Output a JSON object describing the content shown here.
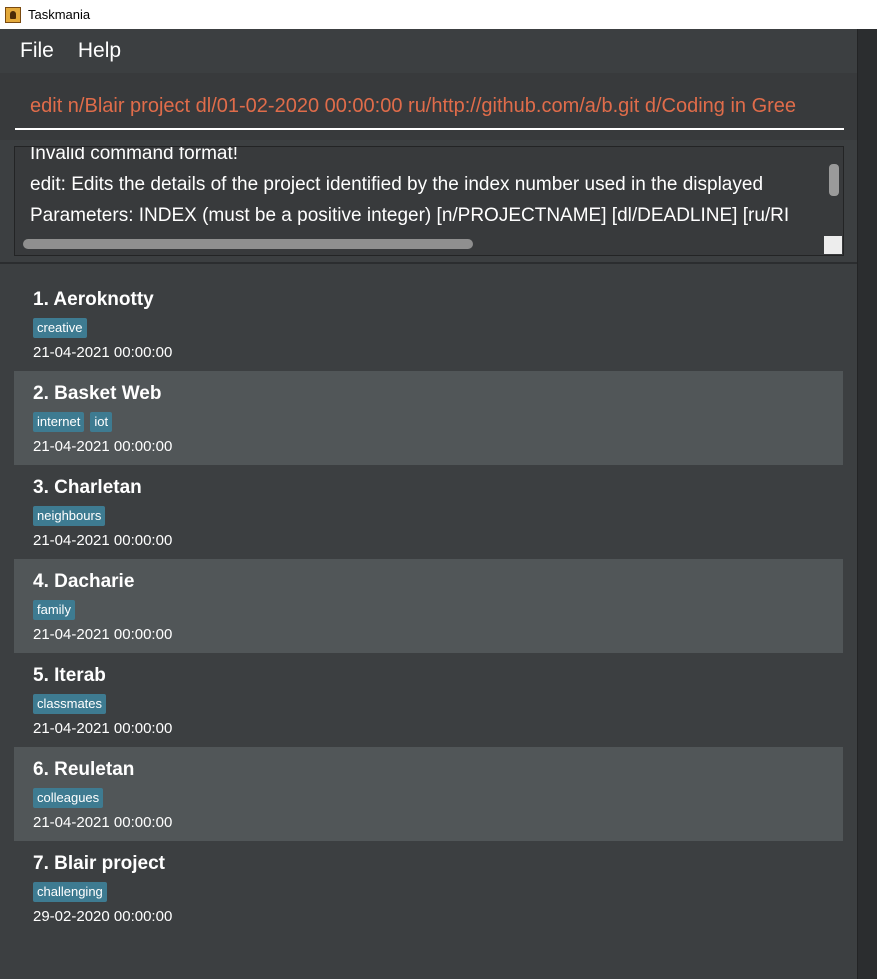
{
  "window": {
    "title": "Taskmania"
  },
  "menu": {
    "file": "File",
    "help": "Help"
  },
  "command": {
    "value": "edit n/Blair project dl/01-02-2020 00:00:00 ru/http://github.com/a/b.git d/Coding in Gree"
  },
  "result": {
    "lines": [
      "Invalid command format!",
      "edit: Edits the details of the project identified by the index number used in the displayed",
      "Parameters: INDEX (must be a positive integer) [n/PROJECTNAME] [dl/DEADLINE] [ru/RI"
    ]
  },
  "projects": [
    {
      "title": "1.  Aeroknotty",
      "tags": [
        "creative"
      ],
      "date": "21-04-2021 00:00:00"
    },
    {
      "title": "2.  Basket Web",
      "tags": [
        "internet",
        "iot"
      ],
      "date": "21-04-2021 00:00:00"
    },
    {
      "title": "3.  Charletan",
      "tags": [
        "neighbours"
      ],
      "date": "21-04-2021 00:00:00"
    },
    {
      "title": "4.  Dacharie",
      "tags": [
        "family"
      ],
      "date": "21-04-2021 00:00:00"
    },
    {
      "title": "5.  Iterab",
      "tags": [
        "classmates"
      ],
      "date": "21-04-2021 00:00:00"
    },
    {
      "title": "6.  Reuletan",
      "tags": [
        "colleagues"
      ],
      "date": "21-04-2021 00:00:00"
    },
    {
      "title": "7.  Blair project",
      "tags": [
        "challenging"
      ],
      "date": "29-02-2020 00:00:00"
    }
  ],
  "colors": {
    "background": "#3c3f41",
    "command_text": "#e06c4a",
    "tag": "#3e7b91",
    "card_alt": "#515658"
  }
}
